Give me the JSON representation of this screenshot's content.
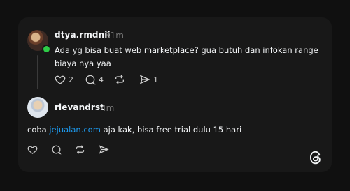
{
  "post": {
    "username": "dtya.rmdnii",
    "time": "31m",
    "text": "Ada yg bisa buat web marketplace? gua butuh dan infokan range biaya nya yaa",
    "likes": "2",
    "comments": "4",
    "reposts": "",
    "shares": "1"
  },
  "reply": {
    "username": "rievandrst",
    "time": "4m",
    "text_before": "coba ",
    "link": "jejualan.com",
    "text_after": " aja kak, bisa free trial dulu 15 hari"
  },
  "icons": {
    "like": "heart-icon",
    "comment": "comment-icon",
    "repost": "repost-icon",
    "share": "send-icon",
    "brand": "threads-logo-icon"
  },
  "colors": {
    "background": "#101010",
    "card": "#181818",
    "online": "#2ecc47",
    "link": "#1d9bf0"
  }
}
